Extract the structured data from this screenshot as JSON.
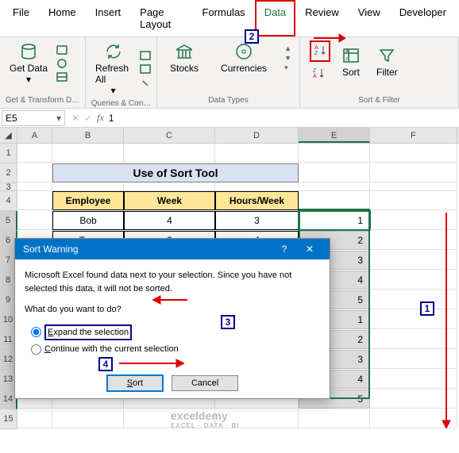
{
  "tabs": [
    "File",
    "Home",
    "Insert",
    "Page Layout",
    "Formulas",
    "Data",
    "Review",
    "View",
    "Developer"
  ],
  "active_tab": "Data",
  "ribbon": {
    "g1": {
      "label": "Get & Transform D…",
      "btn": "Get Data"
    },
    "g2": {
      "label": "Queries & Con…",
      "btn": "Refresh All"
    },
    "g3": {
      "label": "Data Types",
      "s": "Stocks",
      "c": "Currencies"
    },
    "g4": {
      "label": "Sort & Filter",
      "sort": "Sort",
      "filter": "Filter"
    }
  },
  "namebox": "E5",
  "formula": "1",
  "cols": [
    "A",
    "B",
    "C",
    "D",
    "E",
    "F"
  ],
  "title": "Use of Sort Tool",
  "headers": [
    "Employee",
    "Week",
    "Hours/Week"
  ],
  "trows": [
    [
      "Bob",
      "4",
      "3"
    ],
    [
      "Tom",
      "2",
      "4"
    ]
  ],
  "ecol": [
    "1",
    "2",
    "3",
    "4",
    "5",
    "1",
    "2",
    "3",
    "4",
    "5"
  ],
  "dialog": {
    "title": "Sort Warning",
    "msg": "Microsoft Excel found data next to your selection.  Since you have not selected this data, it will not be sorted.",
    "q": "What do you want to do?",
    "o1": "Expand the selection",
    "o2": "Continue with the current selection",
    "sort": "Sort",
    "cancel": "Cancel"
  },
  "callouts": {
    "c1": "1",
    "c2": "2",
    "c3": "3",
    "c4": "4"
  },
  "wm": {
    "t": "exceldemy",
    "s": "EXCEL · DATA · BI"
  }
}
